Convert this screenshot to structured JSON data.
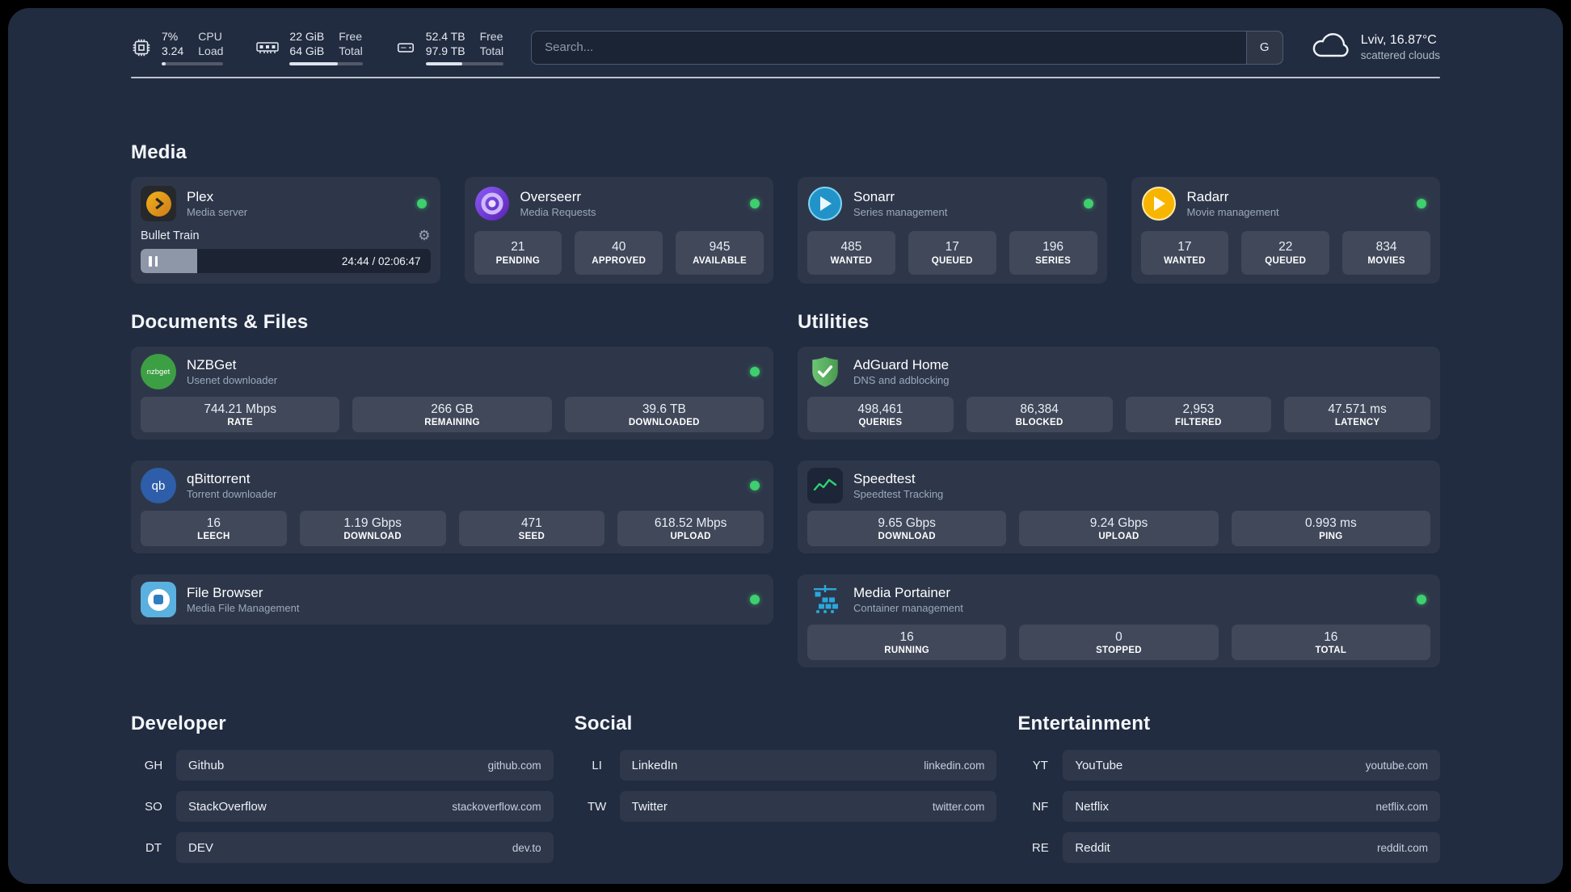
{
  "page": {
    "sections": {
      "media": "Media",
      "documents": "Documents & Files",
      "utilities": "Utilities",
      "developer": "Developer",
      "social": "Social",
      "entertainment": "Entertainment"
    }
  },
  "topbar": {
    "cpu": {
      "value1": "7%",
      "value2": "3.24",
      "label1": "CPU",
      "label2": "Load",
      "used_pct": 7
    },
    "memory": {
      "value1": "22 GiB",
      "value2": "64 GiB",
      "label1": "Free",
      "label2": "Total",
      "used_pct": 66
    },
    "disk": {
      "value1": "52.4 TB",
      "value2": "97.9 TB",
      "label1": "Free",
      "label2": "Total",
      "used_pct": 47
    },
    "search": {
      "placeholder": "Search...",
      "provider_label": "G"
    },
    "weather": {
      "title": "Lviv, 16.87°C",
      "subtitle": "scattered clouds"
    }
  },
  "icons": {
    "gear": "⚙"
  },
  "colors": {
    "status_online": "#3ecf6e",
    "plex_accent": "#e5a00d",
    "sonarr_accent": "#2193c9",
    "radarr_accent": "#f7b500",
    "overseerr_accent": "#8b5cf6",
    "nzbget_accent": "#3c9f43",
    "qbittorrent_accent": "#2e5eaa",
    "adguard_accent": "#5fae63",
    "speedtest_accent": "#2dd36f",
    "portainer_accent": "#2aa7dc"
  },
  "services": {
    "plex": {
      "name": "Plex",
      "subtitle": "Media server",
      "player": {
        "title": "Bullet Train",
        "time": "24:44 / 02:06:47",
        "progress_pct": 19.5
      }
    },
    "overseerr": {
      "name": "Overseerr",
      "subtitle": "Media Requests",
      "stats": [
        {
          "value": "21",
          "label": "PENDING"
        },
        {
          "value": "40",
          "label": "APPROVED"
        },
        {
          "value": "945",
          "label": "AVAILABLE"
        }
      ]
    },
    "sonarr": {
      "name": "Sonarr",
      "subtitle": "Series management",
      "stats": [
        {
          "value": "485",
          "label": "WANTED"
        },
        {
          "value": "17",
          "label": "QUEUED"
        },
        {
          "value": "196",
          "label": "SERIES"
        }
      ]
    },
    "radarr": {
      "name": "Radarr",
      "subtitle": "Movie management",
      "stats": [
        {
          "value": "17",
          "label": "WANTED"
        },
        {
          "value": "22",
          "label": "QUEUED"
        },
        {
          "value": "834",
          "label": "MOVIES"
        }
      ]
    },
    "nzbget": {
      "name": "NZBGet",
      "subtitle": "Usenet downloader",
      "icon_text": "nzbget",
      "stats": [
        {
          "value": "744.21 Mbps",
          "label": "RATE"
        },
        {
          "value": "266 GB",
          "label": "REMAINING"
        },
        {
          "value": "39.6 TB",
          "label": "DOWNLOADED"
        }
      ]
    },
    "qbittorrent": {
      "name": "qBittorrent",
      "subtitle": "Torrent downloader",
      "icon_text": "qb",
      "stats": [
        {
          "value": "16",
          "label": "LEECH"
        },
        {
          "value": "1.19 Gbps",
          "label": "DOWNLOAD"
        },
        {
          "value": "471",
          "label": "SEED"
        },
        {
          "value": "618.52 Mbps",
          "label": "UPLOAD"
        }
      ]
    },
    "filebrowser": {
      "name": "File Browser",
      "subtitle": "Media File Management"
    },
    "adguard": {
      "name": "AdGuard Home",
      "subtitle": "DNS and adblocking",
      "stats": [
        {
          "value": "498,461",
          "label": "QUERIES"
        },
        {
          "value": "86,384",
          "label": "BLOCKED"
        },
        {
          "value": "2,953",
          "label": "FILTERED"
        },
        {
          "value": "47.571 ms",
          "label": "LATENCY"
        }
      ]
    },
    "speedtest": {
      "name": "Speedtest",
      "subtitle": "Speedtest Tracking",
      "stats": [
        {
          "value": "9.65 Gbps",
          "label": "DOWNLOAD"
        },
        {
          "value": "9.24 Gbps",
          "label": "UPLOAD"
        },
        {
          "value": "0.993 ms",
          "label": "PING"
        }
      ]
    },
    "portainer": {
      "name": "Media Portainer",
      "subtitle": "Container management",
      "stats": [
        {
          "value": "16",
          "label": "RUNNING"
        },
        {
          "value": "0",
          "label": "STOPPED"
        },
        {
          "value": "16",
          "label": "TOTAL"
        }
      ]
    }
  },
  "bookmarks": {
    "developer": [
      {
        "abbr": "GH",
        "name": "Github",
        "domain": "github.com"
      },
      {
        "abbr": "SO",
        "name": "StackOverflow",
        "domain": "stackoverflow.com"
      },
      {
        "abbr": "DT",
        "name": "DEV",
        "domain": "dev.to"
      }
    ],
    "social": [
      {
        "abbr": "LI",
        "name": "LinkedIn",
        "domain": "linkedin.com"
      },
      {
        "abbr": "TW",
        "name": "Twitter",
        "domain": "twitter.com"
      }
    ],
    "entertainment": [
      {
        "abbr": "YT",
        "name": "YouTube",
        "domain": "youtube.com"
      },
      {
        "abbr": "NF",
        "name": "Netflix",
        "domain": "netflix.com"
      },
      {
        "abbr": "RE",
        "name": "Reddit",
        "domain": "reddit.com"
      }
    ]
  }
}
